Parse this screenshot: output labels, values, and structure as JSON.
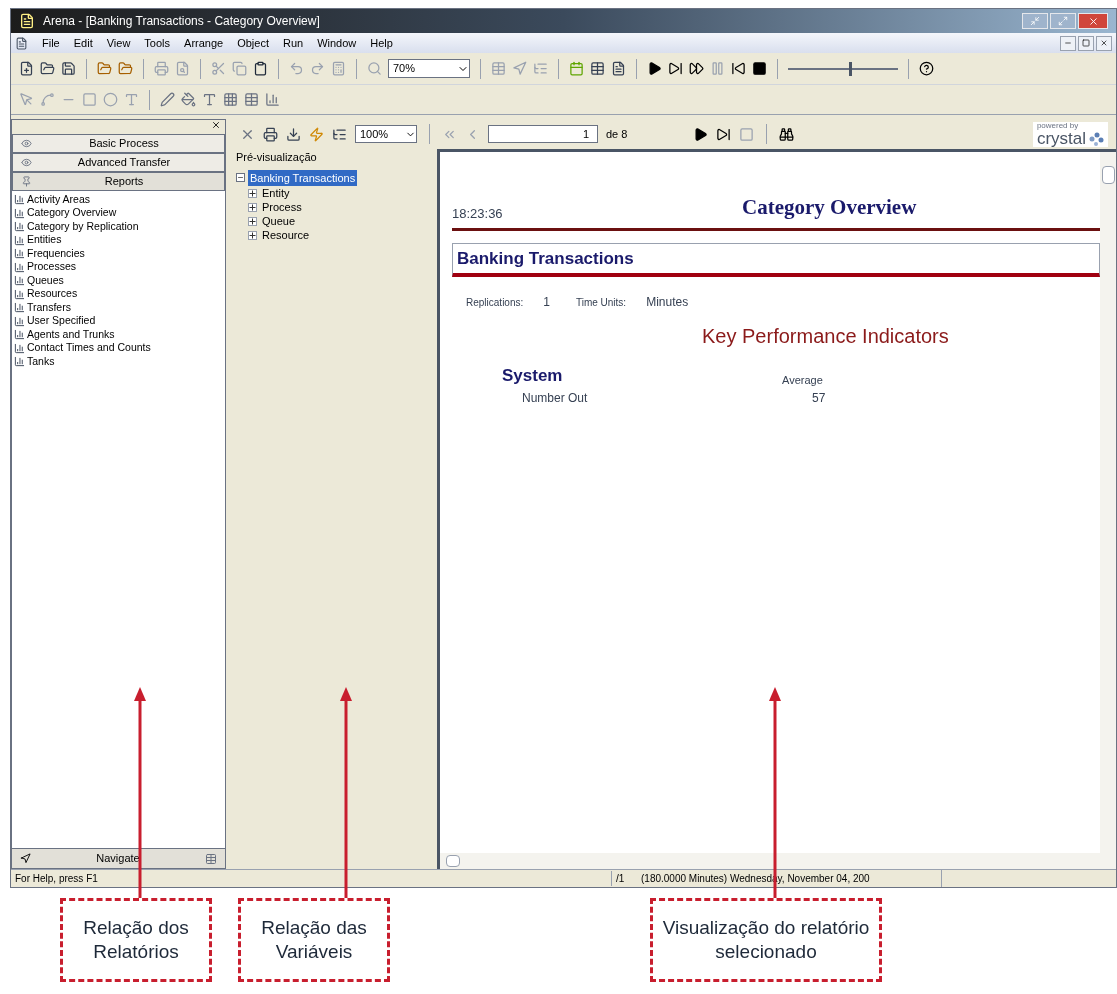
{
  "window": {
    "title": "Arena  - [Banking Transactions - Category Overview]"
  },
  "menu": [
    "File",
    "Edit",
    "View",
    "Tools",
    "Arrange",
    "Object",
    "Run",
    "Window",
    "Help"
  ],
  "toolbar": {
    "zoom": "70%",
    "speed_slider": {
      "level": 0.55
    }
  },
  "project_bar": {
    "panels": [
      {
        "label": "Basic Process",
        "kind": "eye",
        "expanded": false
      },
      {
        "label": "Advanced Transfer",
        "kind": "eye",
        "expanded": false
      },
      {
        "label": "Reports",
        "kind": "pin",
        "expanded": true
      }
    ],
    "reports": [
      "Activity Areas",
      "Category Overview",
      "Category by Replication",
      "Entities",
      "Frequencies",
      "Processes",
      "Queues",
      "Resources",
      "Transfers",
      "User Specified",
      "Agents and Trunks",
      "Contact Times and Counts",
      "Tanks"
    ],
    "navigate": "Navigate"
  },
  "report_toolbar": {
    "zoom": "100%",
    "page": "1",
    "page_total": "de 8",
    "brand_tagline": "powered by",
    "brand": "crystal"
  },
  "tree": {
    "heading": "Pré-visualização",
    "root": {
      "label": "Banking Transactions",
      "selected": true,
      "expanded": true,
      "children": [
        {
          "label": "Entity",
          "selected": false,
          "expanded": false
        },
        {
          "label": "Process",
          "selected": false,
          "expanded": false
        },
        {
          "label": "Queue",
          "selected": false,
          "expanded": false
        },
        {
          "label": "Resource",
          "selected": false,
          "expanded": false
        }
      ]
    }
  },
  "report": {
    "time": "18:23:36",
    "title": "Category Overview",
    "model": "Banking Transactions",
    "fields": [
      {
        "label": "Replications:",
        "value": "1"
      },
      {
        "label": "Time Units:",
        "value": "Minutes"
      }
    ],
    "section": "Key Performance Indicators",
    "group": "System",
    "column": "Average",
    "rows": [
      {
        "label": "Number Out",
        "value": "57"
      }
    ]
  },
  "status_bar": {
    "help": "For Help, press F1",
    "page": "/1",
    "info": "(180.0000 Minutes) Wednesday, November 04, 200"
  },
  "annotations": [
    {
      "text": "Relação dos Relatórios"
    },
    {
      "text": "Relação das Variáveis"
    },
    {
      "text": "Visualização do relatório selecionado"
    }
  ]
}
